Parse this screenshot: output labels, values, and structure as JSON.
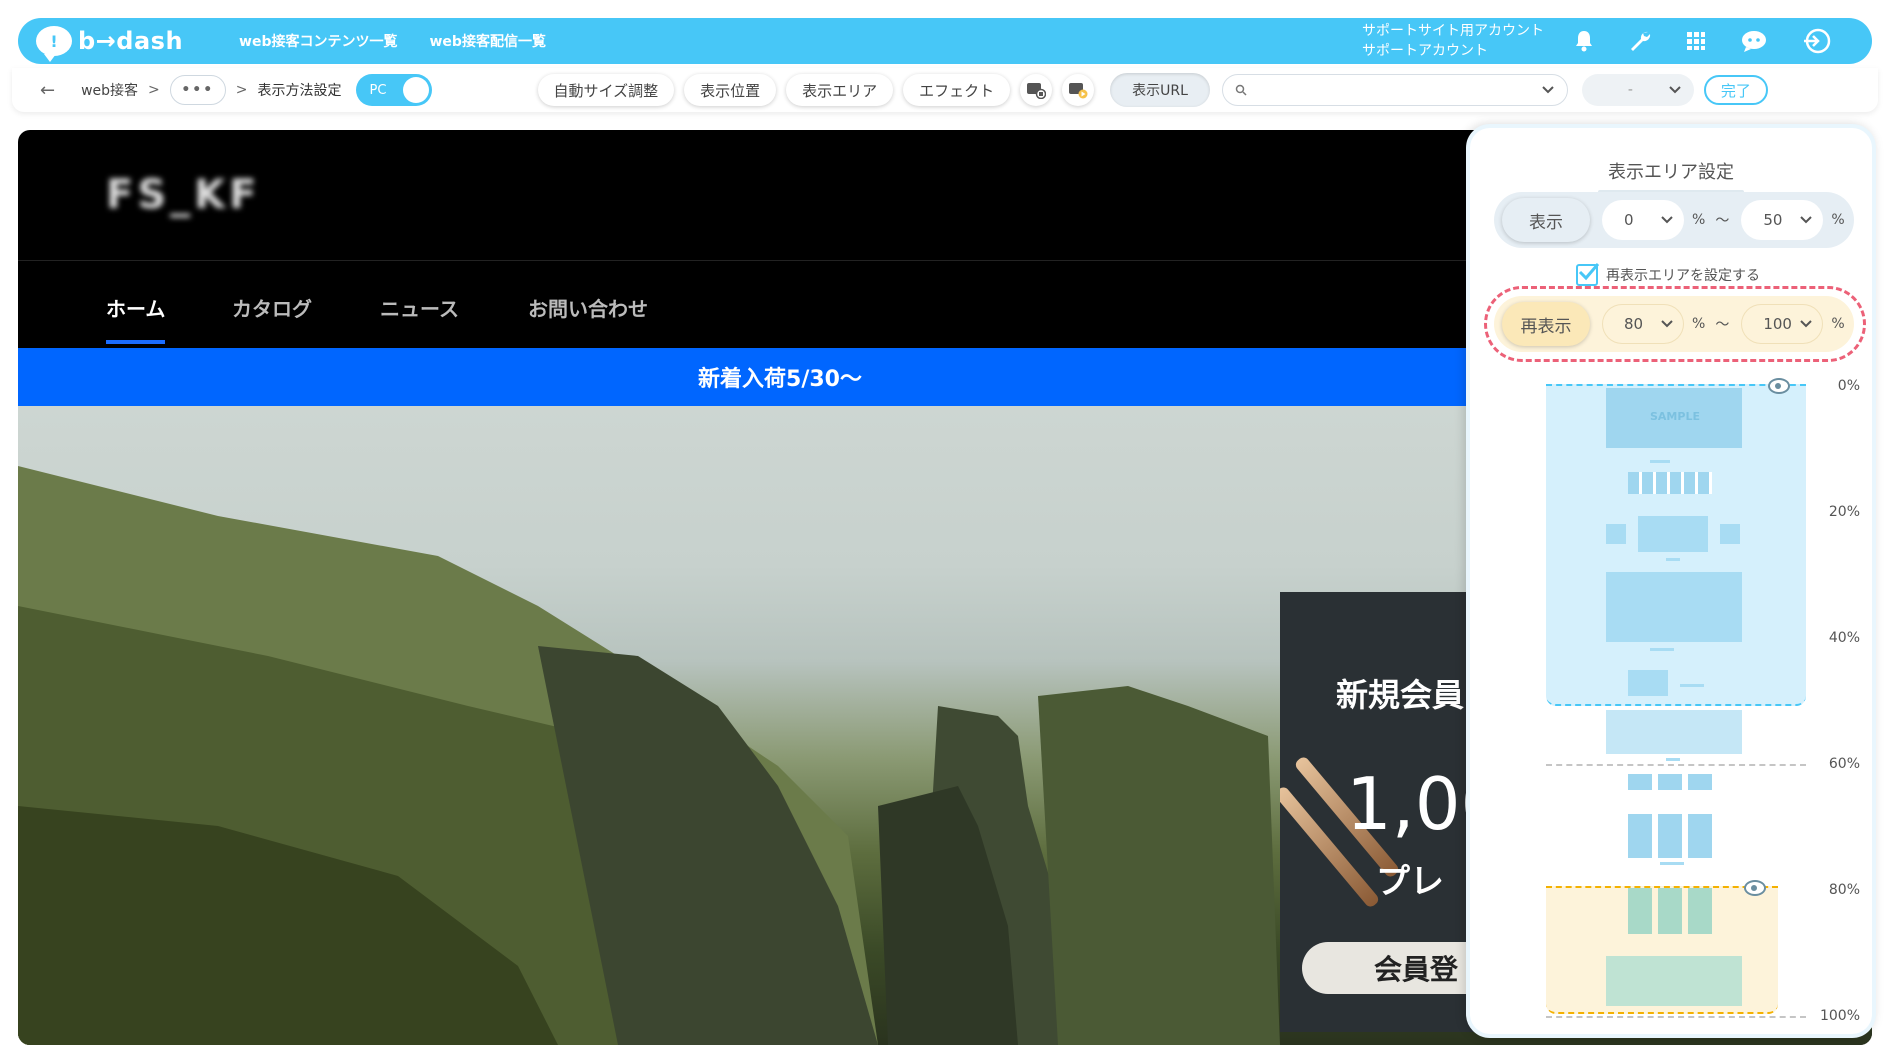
{
  "header": {
    "logo_text": "b→dash",
    "nav": [
      "web接客コンテンツ一覧",
      "web接客配信一覧"
    ],
    "account_line1": "サポートサイト用アカウント",
    "account_line2": "サポートアカウント",
    "icons": [
      "bell-icon",
      "wrench-icon",
      "grid-icon",
      "chat-icon",
      "logout-icon"
    ]
  },
  "toolbar": {
    "back_icon": "←",
    "crumb1": "web接客",
    "sep": ">",
    "more": "•••",
    "crumb2": "表示方法設定",
    "device": "PC",
    "buttons": [
      "自動サイズ調整",
      "表示位置",
      "表示エリア",
      "エフェクト"
    ],
    "url_label": "表示URL",
    "url_placeholder": "",
    "dash_select": "-",
    "done": "完了"
  },
  "preview": {
    "site_logo": "FS_KF",
    "nav": [
      "ホーム",
      "カタログ",
      "ニュース",
      "お問い合わせ"
    ],
    "banner": "新着入荷5/30〜",
    "popup": {
      "line1": "新規会員",
      "line2": "1,00",
      "line3": "プレ",
      "button": "会員登"
    }
  },
  "panel": {
    "title": "表示エリア設定",
    "row1": {
      "label": "表示",
      "from": "0",
      "to": "50",
      "unit": "%",
      "tilde": "〜"
    },
    "checkbox_label": "再表示エリアを設定する",
    "checkbox_checked": true,
    "row2": {
      "label": "再表示",
      "from": "80",
      "to": "100",
      "unit": "%",
      "tilde": "〜"
    },
    "ticks": [
      "0%",
      "20%",
      "40%",
      "60%",
      "80%",
      "100%"
    ],
    "sample_text": "SAMPLE"
  },
  "colors": {
    "brand": "#47c7f7",
    "banner": "#0066ff",
    "highlight": "#ec6178",
    "reshow": "#fdf3da"
  }
}
